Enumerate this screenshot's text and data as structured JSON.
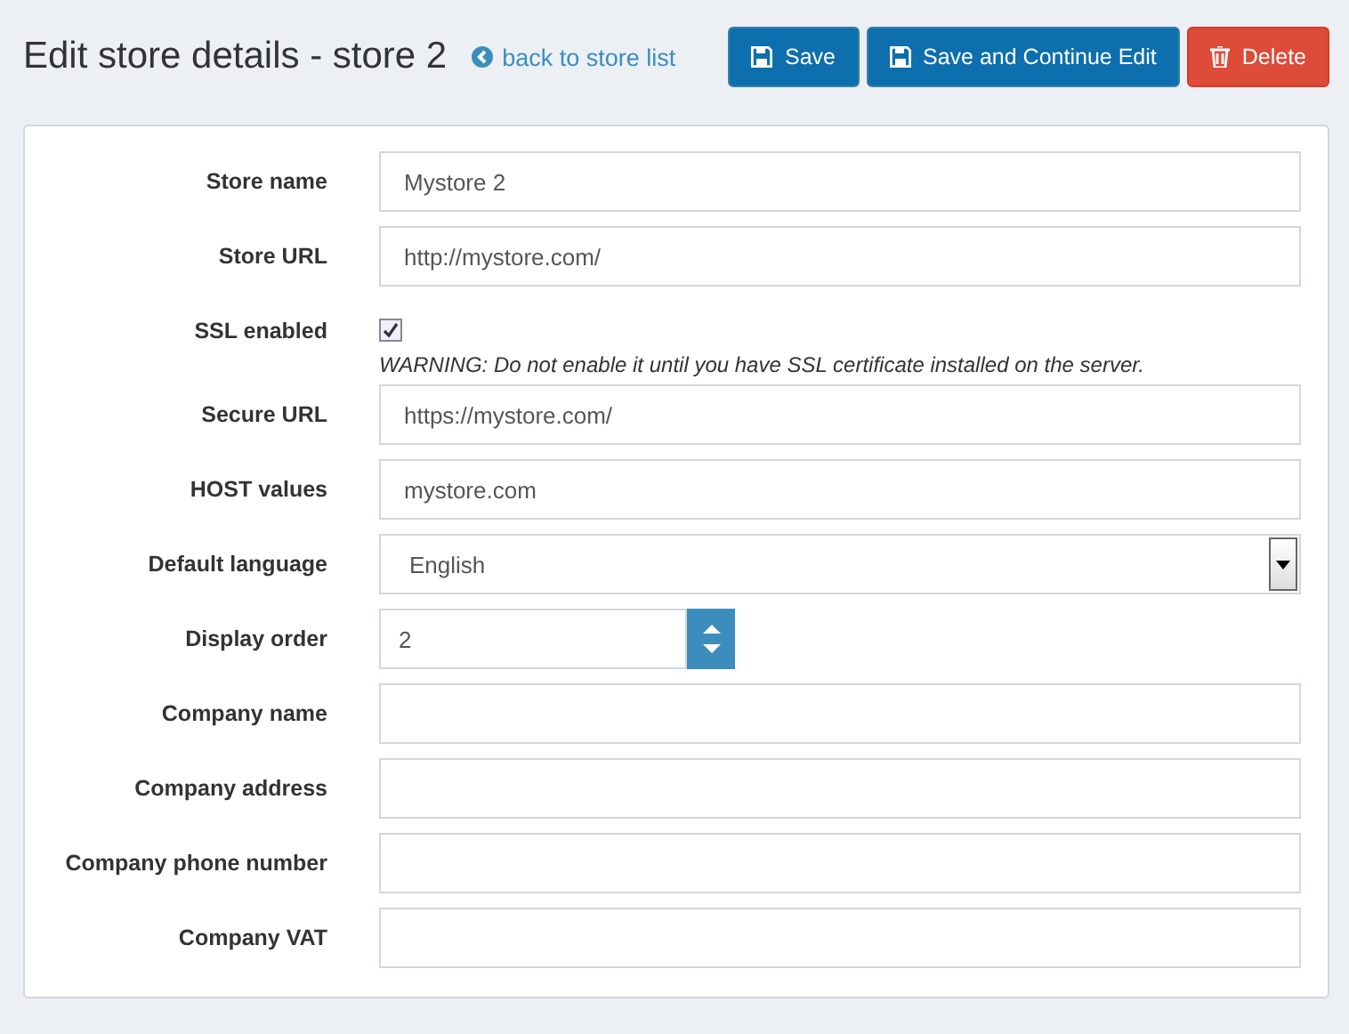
{
  "title": "Edit store details - store 2",
  "back_link": "back to store list",
  "buttons": [
    {
      "label": "Save",
      "kind": "save"
    },
    {
      "label": "Save and Continue Edit",
      "kind": "save"
    },
    {
      "label": "Delete",
      "kind": "delete"
    }
  ],
  "fields": [
    {
      "label": "Store name",
      "kind": "text",
      "value": "Mystore 2"
    },
    {
      "label": "Store URL",
      "kind": "text",
      "value": "http://mystore.com/"
    },
    {
      "label": "SSL enabled",
      "kind": "checkbox",
      "checked": true,
      "note": "WARNING: Do not enable it until you have SSL certificate installed on the server."
    },
    {
      "label": "Secure URL",
      "kind": "text",
      "value": "https://mystore.com/"
    },
    {
      "label": "HOST values",
      "kind": "text",
      "value": "mystore.com"
    },
    {
      "label": "Default language",
      "kind": "select",
      "value": "English"
    },
    {
      "label": "Display order",
      "kind": "number",
      "value": "2"
    },
    {
      "label": "Company name",
      "kind": "text"
    },
    {
      "label": "Company address",
      "kind": "text"
    },
    {
      "label": "Company phone number",
      "kind": "text"
    },
    {
      "label": "Company VAT",
      "kind": "text"
    }
  ]
}
